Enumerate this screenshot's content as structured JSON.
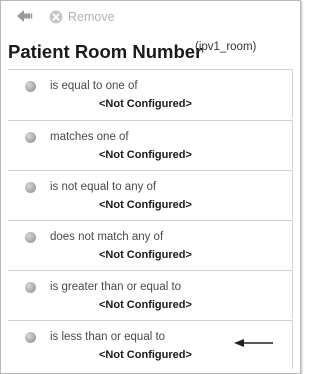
{
  "toolbar": {
    "back_icon": "back-arrow-icon",
    "remove_icon": "remove-x-icon",
    "remove_label": "Remove",
    "disabled_color": "#b2b2b2"
  },
  "header": {
    "title": "Patient Room Number",
    "subtitle": "(ipv1_room)"
  },
  "conditions": [
    {
      "label": "is equal to one of",
      "value": "<Not Configured>"
    },
    {
      "label": "matches one of",
      "value": "<Not Configured>"
    },
    {
      "label": "is not equal to any of",
      "value": "<Not Configured>"
    },
    {
      "label": "does not match any of",
      "value": "<Not Configured>"
    },
    {
      "label": "is greater than or equal to",
      "value": "<Not Configured>"
    },
    {
      "label": "is less than or equal to",
      "value": "<Not Configured>"
    }
  ],
  "annotation": {
    "icon": "pointer-arrow-icon",
    "target_index": 5
  }
}
